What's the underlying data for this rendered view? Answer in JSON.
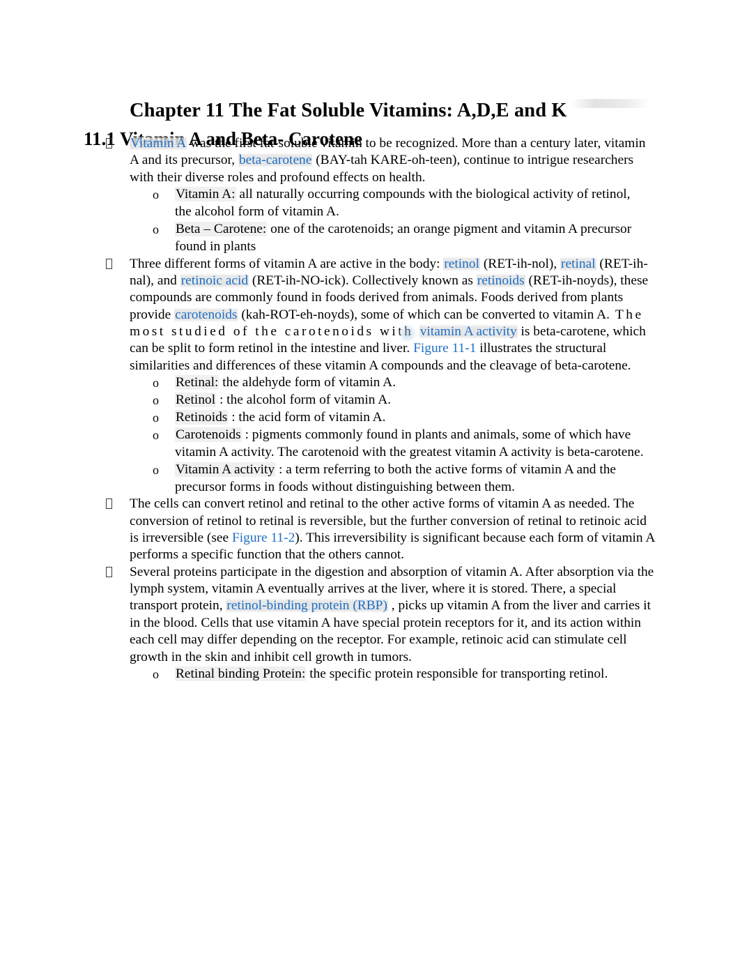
{
  "document": {
    "title": "Chapter 11 The Fat Soluble Vitamins: A,D,E and K",
    "subtitle": "11.1 Vitamin A and Beta- Carotene"
  },
  "markers": {
    "level1": "❑",
    "level2": "o"
  },
  "colors": {
    "link_blue": "#1f6fc4",
    "text_black": "#000000",
    "highlight_gray": "#e4e4e4",
    "page_background": "#ffffff"
  },
  "content": {
    "bullet1": {
      "term": "Vitamin A",
      "text_a": " was the first fat-soluble vitamin to be recognized. More than a century later, vitamin A and its precursor, ",
      "term2": "beta-carotene",
      "text_b": " (BAY-tah KARE-oh-teen), continue to intrigue researchers with their diverse roles and profound effects on health.",
      "sub": [
        {
          "label": "Vitamin A:",
          "definition": " all naturally occurring compounds with the biological activity of retinol, the alcohol form of vitamin A."
        },
        {
          "label": "Beta – Carotene:",
          "definition": "  one of the carotenoids; an orange pigment and vitamin A precursor found in plants"
        }
      ]
    },
    "bullet2": {
      "text_a": "Three different forms of vitamin A are active in the body: ",
      "term_retinol": "retinol",
      "text_b": " (RET-ih-nol), ",
      "term_retinal": "retinal",
      "text_c": " (RET-ih-nal), and ",
      "term_retinoic_acid": "retinoic acid",
      "text_d": " (RET-ih-NO-ick). Collectively known as ",
      "term_retinoids": "retinoids",
      "text_e": " (RET-ih-noyds), these compounds are commonly found in foods derived from animals. Foods derived from plants provide ",
      "term_carotenoids": "carotenoids",
      "text_f": " (kah-ROT-eh-noyds), some of which can be converted to vitamin A.",
      "text_g": "  The most studied of the carotenoids with ",
      "term_vitamin_a_activity": "vitamin A activity",
      "text_h": " is beta-carotene, which can be split to form retinol in the intestine and liver. ",
      "term_figure_11_1": "Figure 11-1",
      "text_i": " illustrates the structural similarities and differences of these vitamin A compounds and the cleavage of beta-carotene.",
      "sub": [
        {
          "label": "Retinal:",
          "definition": " the aldehyde form of vitamin A."
        },
        {
          "label": "Retinol",
          "definition": " : the alcohol form of vitamin A."
        },
        {
          "label": "Retinoids",
          "definition": " : the acid form of vitamin A."
        },
        {
          "label": "Carotenoids",
          "definition": " : pigments commonly found in plants and animals, some of which have vitamin A activity. The carotenoid with the greatest vitamin A activity is beta-carotene."
        },
        {
          "label": "Vitamin A activity",
          "definition": " : a term referring to both the active forms of vitamin A and the precursor forms in foods without distinguishing between them."
        }
      ]
    },
    "bullet3": {
      "text_a": "The cells can convert retinol and retinal to the other active forms of vitamin A as needed. The conversion of retinol to retinal is reversible, but the further conversion of retinal to retinoic acid is irreversible (see ",
      "term_figure_11_2": "Figure 11-2",
      "text_b": "). This irreversibility is significant because each form of vitamin A performs a specific function that the others cannot."
    },
    "bullet4": {
      "text_a": "Several proteins participate in the digestion and absorption of vitamin A. After absorption via the lymph system, vitamin A eventually arrives at the liver, where it is stored. There, a special transport protein, ",
      "term_rbp": "retinol-binding protein (RBP)",
      "text_b": " , picks up vitamin A from the liver and carries it in the blood. Cells that use vitamin A have special protein receptors for it, and its action within each cell may differ depending on the receptor. For example, retinoic acid can stimulate cell growth in the skin and inhibit cell growth in tumors.",
      "sub": [
        {
          "label": "Retinal binding Protein:",
          "definition": "   the specific protein responsible for transporting retinol."
        }
      ]
    }
  }
}
